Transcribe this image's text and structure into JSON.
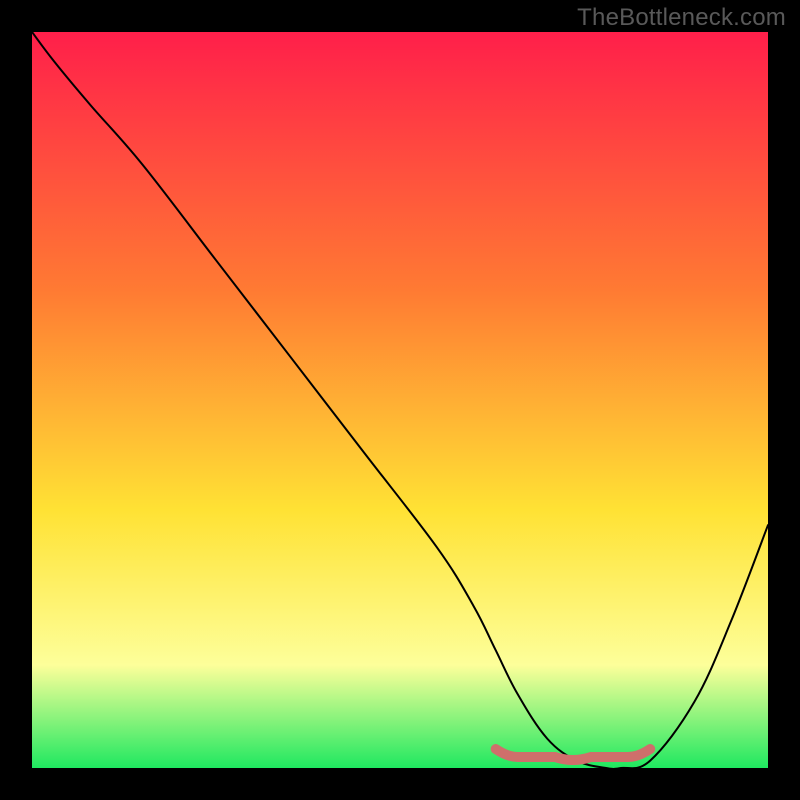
{
  "watermark": "TheBottleneck.com",
  "colors": {
    "gradient_stops": [
      {
        "offset": "0%",
        "color": "#ff1f4a"
      },
      {
        "offset": "35%",
        "color": "#ff7a33"
      },
      {
        "offset": "65%",
        "color": "#ffe234"
      },
      {
        "offset": "86%",
        "color": "#fdff9a"
      },
      {
        "offset": "100%",
        "color": "#1fe860"
      }
    ],
    "curve_stroke": "#000000",
    "highlight_stroke": "#cf6f6b",
    "frame_background": "#000000"
  },
  "chart_data": {
    "type": "line",
    "title": "",
    "xlabel": "",
    "ylabel": "",
    "xlim": [
      0,
      100
    ],
    "ylim": [
      0,
      100
    ],
    "grid": false,
    "legend": false,
    "series": [
      {
        "name": "bottleneck_curve",
        "x": [
          0,
          3,
          8,
          15,
          25,
          35,
          45,
          55,
          60,
          63,
          66,
          70,
          74,
          78,
          80,
          84,
          90,
          95,
          100
        ],
        "y": [
          100,
          96,
          90,
          82,
          69,
          56,
          43,
          30,
          22,
          16,
          10,
          4,
          1,
          0,
          0,
          1,
          9,
          20,
          33
        ]
      }
    ],
    "optimal_zone": {
      "x_start": 63,
      "x_end": 84,
      "y": 1.5
    }
  }
}
